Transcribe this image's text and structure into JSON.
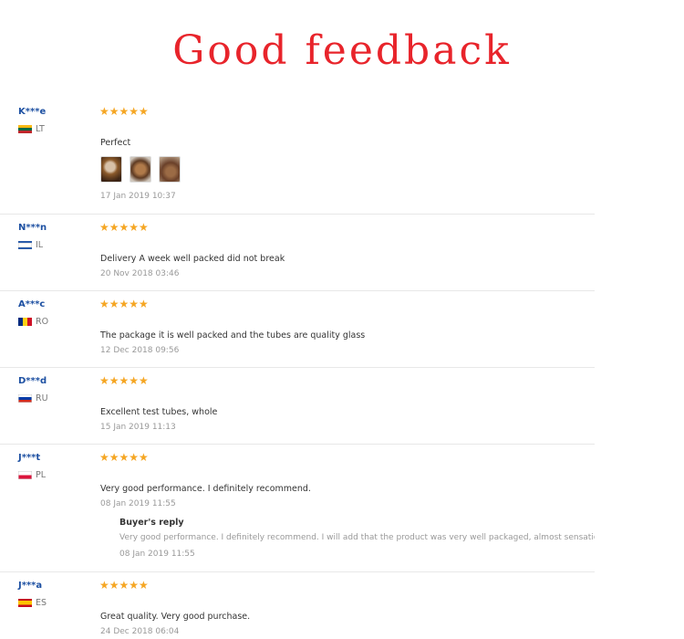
{
  "header": {
    "title": "Good feedback"
  },
  "colors": {
    "title": "#e8242b",
    "username": "#1d50a2",
    "star": "#f5a623"
  },
  "star_icons": "★★★★★",
  "reviews": [
    {
      "user": "K***e",
      "country": "LT",
      "rating": 5,
      "text": "Perfect",
      "date": "17 Jan 2019 10:37",
      "photos": 3
    },
    {
      "user": "N***n",
      "country": "IL",
      "rating": 5,
      "text": "Delivery A week well packed did not break",
      "date": "20 Nov 2018 03:46"
    },
    {
      "user": "A***c",
      "country": "RO",
      "rating": 5,
      "text": "The package it is well packed and the tubes are quality glass",
      "date": "12 Dec 2018 09:56"
    },
    {
      "user": "D***d",
      "country": "RU",
      "rating": 5,
      "text": "Excellent test tubes, whole",
      "date": "15 Jan 2019 11:13"
    },
    {
      "user": "J***t",
      "country": "PL",
      "rating": 5,
      "text": "Very good performance. I definitely recommend.",
      "date": "08 Jan 2019 11:55",
      "reply": {
        "title": "Buyer's reply",
        "text": "Very good performance. I definitely recommend. I will add that the product was very well packaged, almost sensational s",
        "date": "08 Jan 2019 11:55"
      }
    },
    {
      "user": "J***a",
      "country": "ES",
      "rating": 5,
      "text": "Great quality. Very good purchase.",
      "date": "24 Dec 2018 06:04"
    }
  ]
}
